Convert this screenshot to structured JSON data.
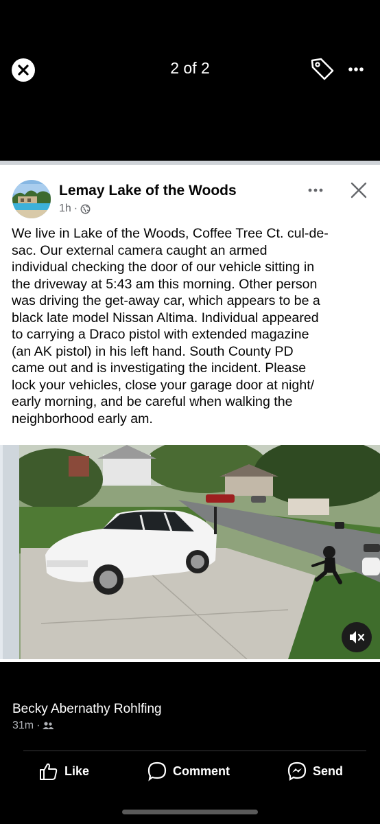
{
  "viewer": {
    "counter": "2 of 2",
    "icons": [
      "close-icon",
      "tag-icon",
      "more-icon"
    ]
  },
  "post": {
    "page_name": "Lemay Lake of the Woods",
    "time": "1h",
    "separator": "·",
    "audience_icon": "globe-icon",
    "text_lines": [
      "We live in Lake of the Woods, Coffee Tree Ct. cul-de-",
      "sac.  Our external camera caught an armed",
      "individual checking the door of our vehicle sitting in",
      "the driveway at 5:43 am this morning.  Other person",
      "was driving the get-away car, which appears to be a",
      "black late model Nissan Altima.  Individual appeared",
      "to carrying a Draco pistol with extended magazine",
      "(an AK pistol) in his left hand.  South County PD",
      "came out and is investigating the incident.   Please",
      "lock your vehicles, close your garage door at night/",
      "early morning, and be careful when walking the",
      "neighborhood early am."
    ],
    "video": {
      "muted_icon": "speaker-muted-icon"
    }
  },
  "comment": {
    "author": "Becky Abernathy Rohlfing",
    "time": "31m",
    "separator": "·",
    "audience_icon": "friends-icon"
  },
  "actions": {
    "like": "Like",
    "comment": "Comment",
    "send": "Send"
  },
  "colors": {
    "background": "#000000",
    "card": "#ffffff",
    "meta_gray": "#65676b"
  }
}
